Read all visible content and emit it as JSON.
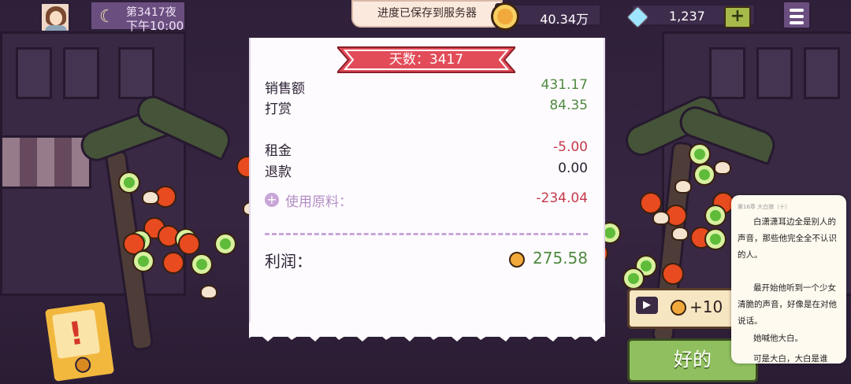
{
  "top": {
    "night_label": "第3417夜",
    "time_label": "下午10:00",
    "coins": "40.34万",
    "gems": "1,237",
    "gem_plus": "+",
    "toast": "进度已保存到服务器"
  },
  "receipt": {
    "title": "天数：3417",
    "sales": {
      "label": "销售额",
      "value": "431.17"
    },
    "tips": {
      "label": "打赏",
      "value": "84.35"
    },
    "rent": {
      "label": "租金",
      "value": "-5.00"
    },
    "refund": {
      "label": "退款",
      "value": "0.00"
    },
    "ingredients": {
      "label": "使用原料：",
      "value": "-234.04",
      "icon": "plus-circle-icon"
    },
    "profit": {
      "label": "利润：",
      "value": "275.58"
    }
  },
  "actions": {
    "ad_reward": "+10",
    "ok": "好的"
  },
  "reader_overlay": {
    "header": "第16章 大白狼（十）",
    "paragraphs": [
      "白潇潇耳边全是别人的声音，那些他完全全不认识的人。",
      "最开始他听到一个少女清脆的声音，好像是在对他说话。",
      "她喊他大白。",
      "可是大白，大白是谁"
    ]
  },
  "colors": {
    "positive": "#4f8a3f",
    "negative": "#c4394b",
    "ribbon": "#e24b58",
    "ok_button": "#8fbf5e"
  }
}
